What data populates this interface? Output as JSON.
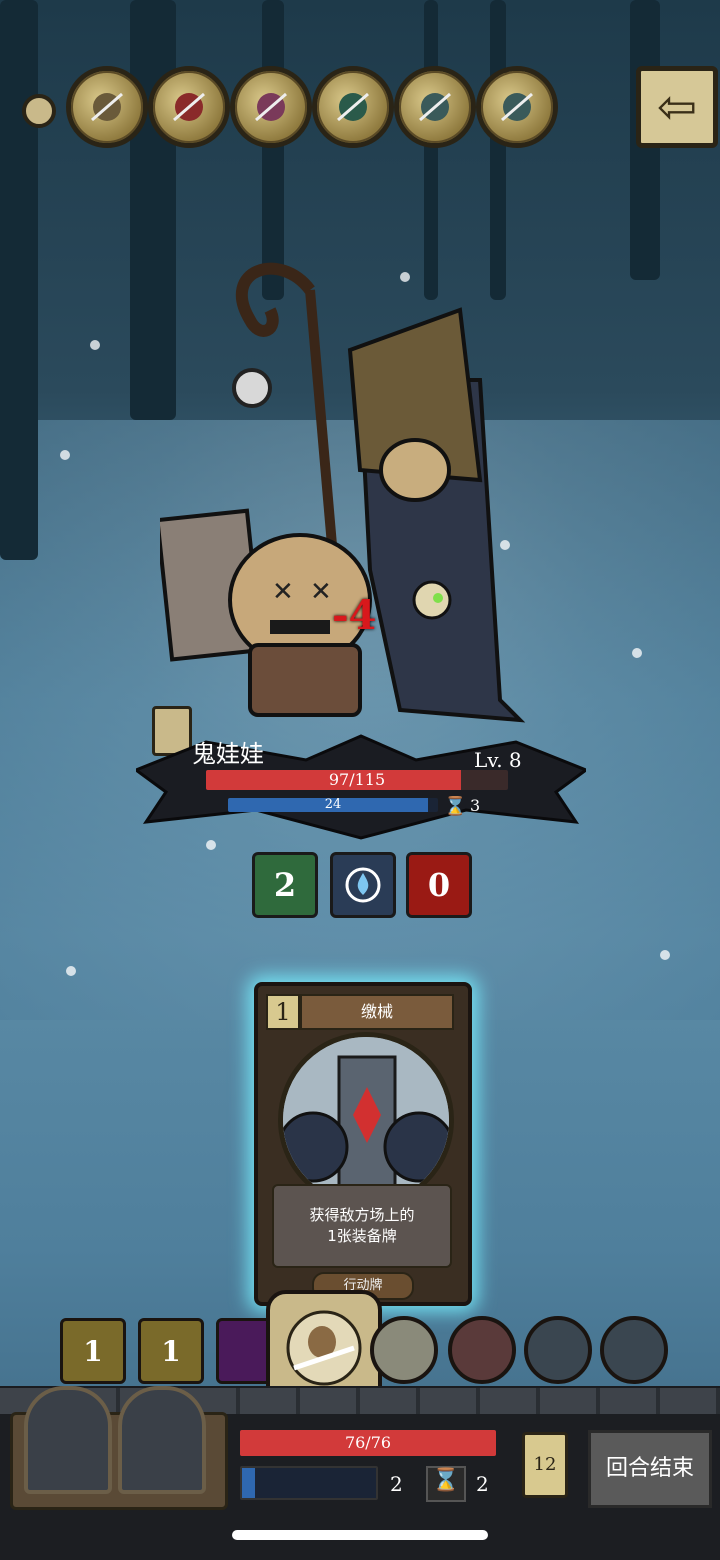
{
  "relics": [
    {
      "name": "cat-relic"
    },
    {
      "name": "girl-relic"
    },
    {
      "name": "hammer-relic"
    },
    {
      "name": "claw-relic"
    },
    {
      "name": "blades-relic"
    },
    {
      "name": "blades-relic-2"
    }
  ],
  "back_icon": "arrow-left-icon",
  "enemy": {
    "name": "鬼娃娃",
    "level": "Lv. 8",
    "hp_text": "97/115",
    "hp_fraction": 0.843,
    "shield_text": "24",
    "shield_fraction": 0.95,
    "timer": "3",
    "damage_popup": "-4"
  },
  "status_effects": [
    {
      "icon": "poison-icon",
      "value": "2",
      "color": "#2f6a3c"
    },
    {
      "icon": "water-drop-icon",
      "value": "",
      "color": "#2a3c56"
    },
    {
      "icon": "fire-icon",
      "value": "0",
      "color": "#9a1a14"
    }
  ],
  "card": {
    "cost": "1",
    "title": "缴械",
    "desc_line1": "获得敌方场上的",
    "desc_line2": "1张装备牌",
    "type": "行动牌"
  },
  "hand": [
    {
      "kind": "boot",
      "value": "1",
      "color": "#7a6a2a"
    },
    {
      "kind": "boot",
      "value": "1",
      "color": "#7a6a2a"
    },
    {
      "kind": "magic",
      "value": "",
      "color": "#4a1a5a"
    }
  ],
  "hand_rounds": [
    {
      "name": "bear-card-icon"
    },
    {
      "name": "skull-flower-icon"
    },
    {
      "name": "hooded-mage-icon"
    },
    {
      "name": "bat-wing-icon"
    },
    {
      "name": "bat-wing-icon-2"
    }
  ],
  "player": {
    "hp_text": "76/76",
    "hp_fraction": 1.0,
    "energy_fraction": 0.1,
    "energy": "2",
    "timer": "2",
    "deck_count": "12",
    "end_turn_label": "回合结束"
  },
  "colors": {
    "hp": "#d23a3a",
    "shield": "#2f68b0",
    "glow": "#78f0ff"
  }
}
